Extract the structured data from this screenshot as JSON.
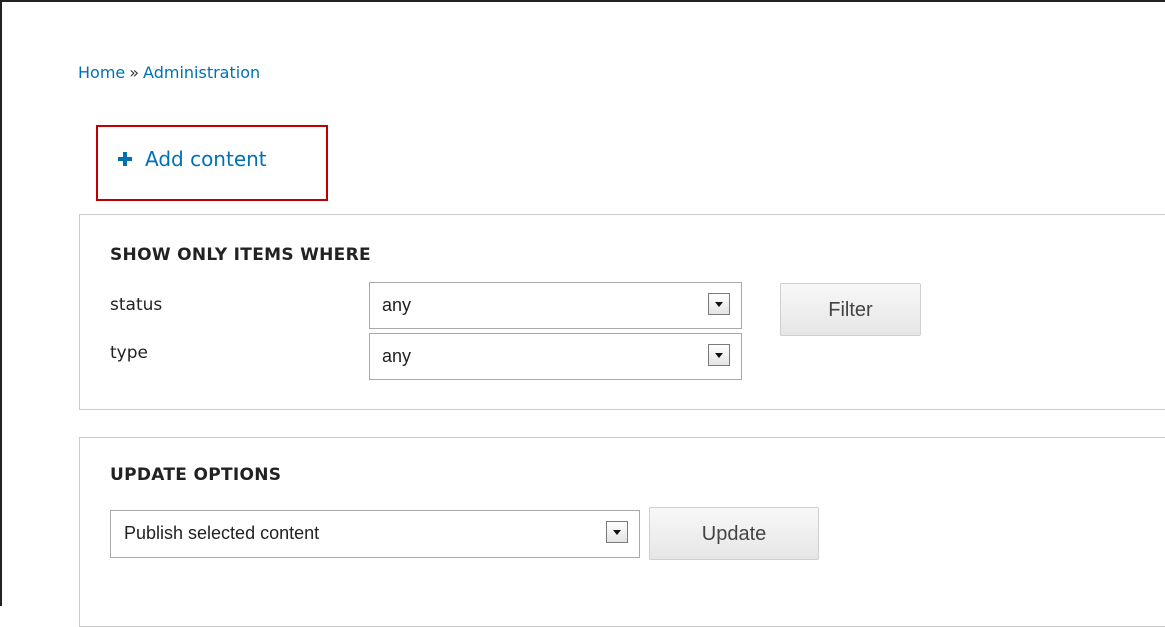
{
  "breadcrumb": {
    "items": [
      "Home",
      "Administration"
    ],
    "separator": "»"
  },
  "actions": {
    "add_content": {
      "label": "Add content",
      "icon": "plus-icon"
    }
  },
  "filter": {
    "legend": "SHOW ONLY ITEMS WHERE",
    "status": {
      "label": "status",
      "value": "any"
    },
    "type": {
      "label": "type",
      "value": "any"
    },
    "button_label": "Filter"
  },
  "update": {
    "legend": "UPDATE OPTIONS",
    "operation": {
      "value": "Publish selected content"
    },
    "button_label": "Update"
  },
  "colors": {
    "link": "#0071b3",
    "highlight": "#c00000"
  }
}
